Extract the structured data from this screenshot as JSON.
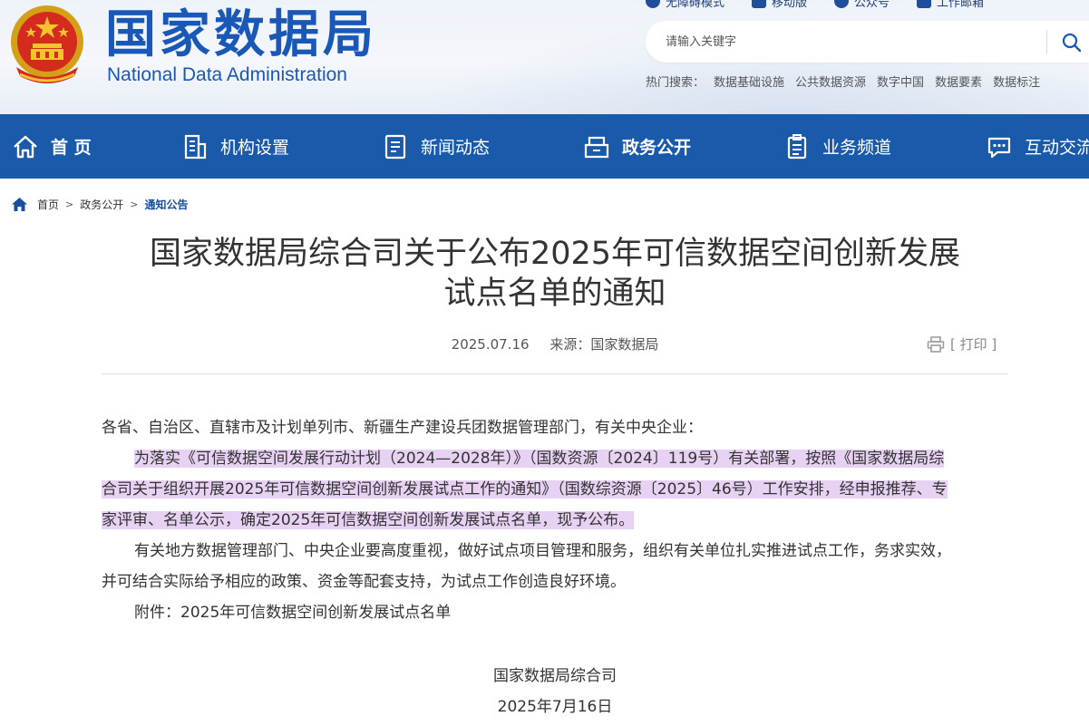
{
  "header": {
    "site_name_cn": "国家数据局",
    "site_name_en": "National Data Administration",
    "top_links": [
      "无障碍模式",
      "移动版",
      "公众号",
      "工作邮箱"
    ],
    "search_placeholder": "请输入关键字",
    "hot_label": "热门搜索：",
    "hot_items": [
      "数据基础设施",
      "公共数据资源",
      "数字中国",
      "数据要素",
      "数据标注"
    ]
  },
  "nav": {
    "items": [
      {
        "label": "首 页",
        "icon": "home-icon"
      },
      {
        "label": "机构设置",
        "icon": "building-icon"
      },
      {
        "label": "新闻动态",
        "icon": "document-icon"
      },
      {
        "label": "政务公开",
        "icon": "open-box-icon"
      },
      {
        "label": "业务频道",
        "icon": "clipboard-icon"
      },
      {
        "label": "互动交流",
        "icon": "chat-icon"
      }
    ]
  },
  "breadcrumb": {
    "items": [
      "首页",
      "政务公开",
      "通知公告"
    ],
    "separator": ">"
  },
  "article": {
    "title_line1": "国家数据局综合司关于公布2025年可信数据空间创新发展",
    "title_line2": "试点名单的通知",
    "date": "2025.07.16",
    "source": "来源：国家数据局",
    "print_label": "[ 打印 ]",
    "salutation": "各省、自治区、直辖市及计划单列市、新疆生产建设兵团数据管理部门，有关中央企业：",
    "para1_line1": "为落实《可信数据空间发展行动计划（2024—2028年）》（国数资源〔2024〕119号）有关部署，按照《国家数据局综",
    "para1_line2": "合司关于组织开展2025年可信数据空间创新发展试点工作的通知》（国数综资源〔2025〕46号）工作安排，经申报推荐、专",
    "para1_line3": "家评审、名单公示，确定2025年可信数据空间创新发展试点名单，现予公布。",
    "para2_line1": "有关地方数据管理部门、中央企业要高度重视，做好试点项目管理和服务，组织有关单位扎实推进试点工作，务求实效，",
    "para2_line2": "并可结合实际给予相应的政策、资金等配套支持，为试点工作创造良好环境。",
    "attachment": "附件：2025年可信数据空间创新发展试点名单",
    "signature_org": "国家数据局综合司",
    "signature_date": "2025年7月16日"
  },
  "colors": {
    "brand_blue": "#1a58b8",
    "nav_bg": "#1a5aab",
    "highlight": "#e7d2f4"
  }
}
